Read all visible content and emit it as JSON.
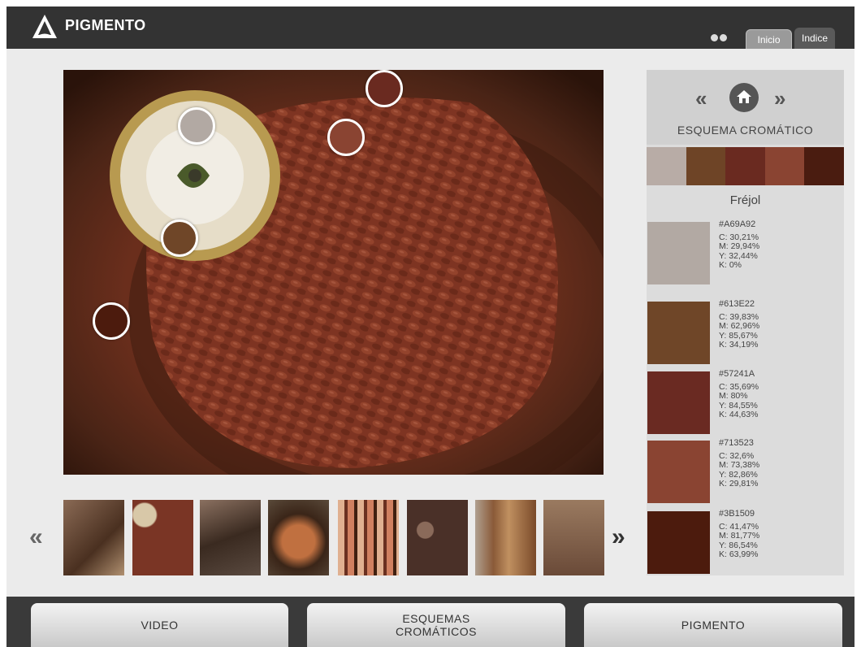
{
  "header": {
    "brand": "PIGMENTO",
    "tabs": [
      {
        "label": "Inicio"
      },
      {
        "label": "Indice"
      }
    ]
  },
  "panel": {
    "scheme_title": "ESQUEMA CROMÁTICO",
    "subject": "Fréjol",
    "strip_colors": [
      "#b8aca6",
      "#6e4426",
      "#6a2a20",
      "#8a4432",
      "#4a1c10"
    ],
    "colors": [
      {
        "hex": "#A69A92",
        "swatch": "#b2a9a3",
        "c": "C: 30,21%",
        "m": "M: 29,94%",
        "y": "Y: 32,44%",
        "k": "K: 0%"
      },
      {
        "hex": "#613E22",
        "swatch": "#6f4628",
        "c": "C: 39,83%",
        "m": "M: 62,96%",
        "y": "Y: 85,67%",
        "k": "K: 34,19%"
      },
      {
        "hex": "#57241A",
        "swatch": "#6a2a22",
        "c": "C: 35,69%",
        "m": "M: 80%",
        "y": "Y: 84,55%",
        "k": "K: 44,63%"
      },
      {
        "hex": "#713523",
        "swatch": "#8a4432",
        "c": "C: 32,6%",
        "m": "M: 73,38%",
        "y": "Y: 82,86%",
        "k": "K: 29,81%"
      },
      {
        "hex": "#3B1509",
        "swatch": "#4c1b0d",
        "c": "C: 41,47%",
        "m": "M: 81,77%",
        "y": "Y: 86,54%",
        "k": "K: 63,99%"
      }
    ]
  },
  "bottom": {
    "video": "VIDEO",
    "esquemas_line1": "ESQUEMAS",
    "esquemas_line2": "CROMÁTICOS",
    "pigmento": "PIGMENTO"
  },
  "icons": {
    "prev": "«",
    "next": "»"
  },
  "thumbnails": [
    {
      "name": "woven-baskets",
      "color": "#8a6a55"
    },
    {
      "name": "beans-plate",
      "color": "#7a3525"
    },
    {
      "name": "dried-pods",
      "color": "#4a3a30"
    },
    {
      "name": "gourd",
      "color": "#5a3a25"
    },
    {
      "name": "colored-tubes",
      "color": "#c08a70"
    },
    {
      "name": "cocoa-beans",
      "color": "#6a4a3a"
    },
    {
      "name": "wooden-vessel",
      "color": "#9a7a60"
    },
    {
      "name": "wooden-lock",
      "color": "#7a5a48"
    }
  ]
}
